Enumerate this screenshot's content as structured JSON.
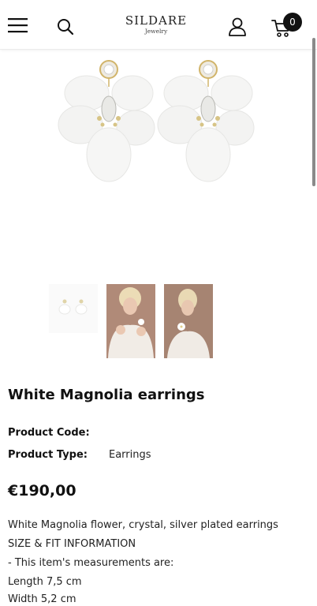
{
  "brand": {
    "name": "SILDARE",
    "tagline": "Jewelry"
  },
  "header": {
    "cart_count": "0"
  },
  "product": {
    "title": "White Magnolia earrings",
    "code_label": "Product Code:",
    "code_value": "",
    "type_label": "Product Type:",
    "type_value": "Earrings",
    "price": "€190,00",
    "description": [
      "White Magnolia flower, crystal, silver plated earrings",
      "SIZE & FIT INFORMATION",
      "- This item's measurements are:",
      "Length 7,5 cm",
      "Width 5,2 cm"
    ]
  },
  "icons": {
    "menu": "hamburger-menu-icon",
    "search": "search-icon",
    "account": "user-icon",
    "cart": "cart-icon"
  },
  "colors": {
    "accent": "#111111",
    "background": "#ffffff"
  }
}
